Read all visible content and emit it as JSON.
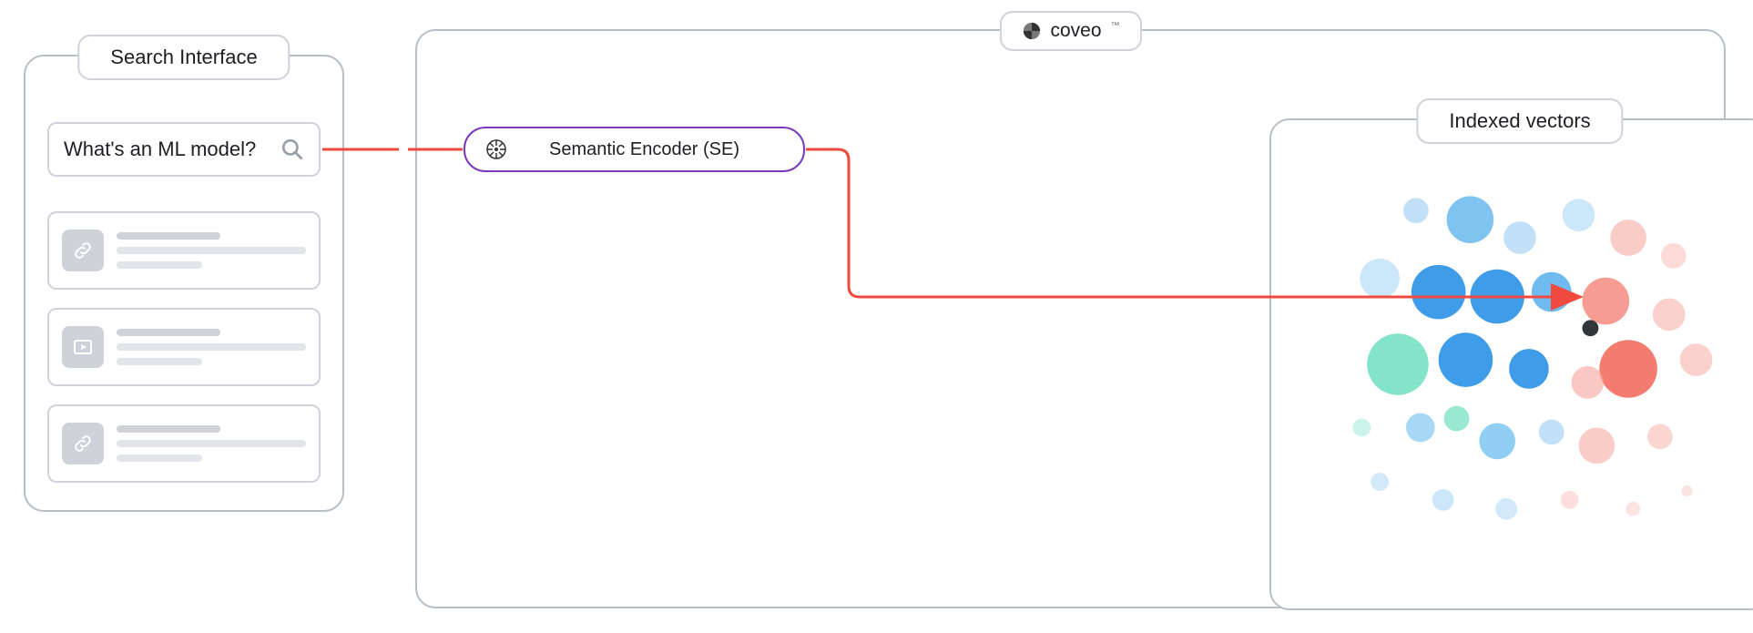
{
  "search_interface": {
    "title": "Search Interface",
    "query": "What's an ML model?",
    "search_icon": "search-icon"
  },
  "encoder": {
    "label": "Semantic Encoder (SE)",
    "icon": "ml-brain-icon"
  },
  "coveo": {
    "brand": "coveo",
    "trademark": "™"
  },
  "vectors_panel": {
    "title": "Indexed vectors"
  },
  "colors": {
    "border_grey": "#b8bec6",
    "line_grey": "#cfd3d9",
    "encoder_border": "#7b3ab8",
    "flow_red": "#f04a3e",
    "dot_blue": "#4fa9e8",
    "dot_teal": "#5fd9b9",
    "dot_red": "#f3867e",
    "query_dot": "#333639"
  }
}
